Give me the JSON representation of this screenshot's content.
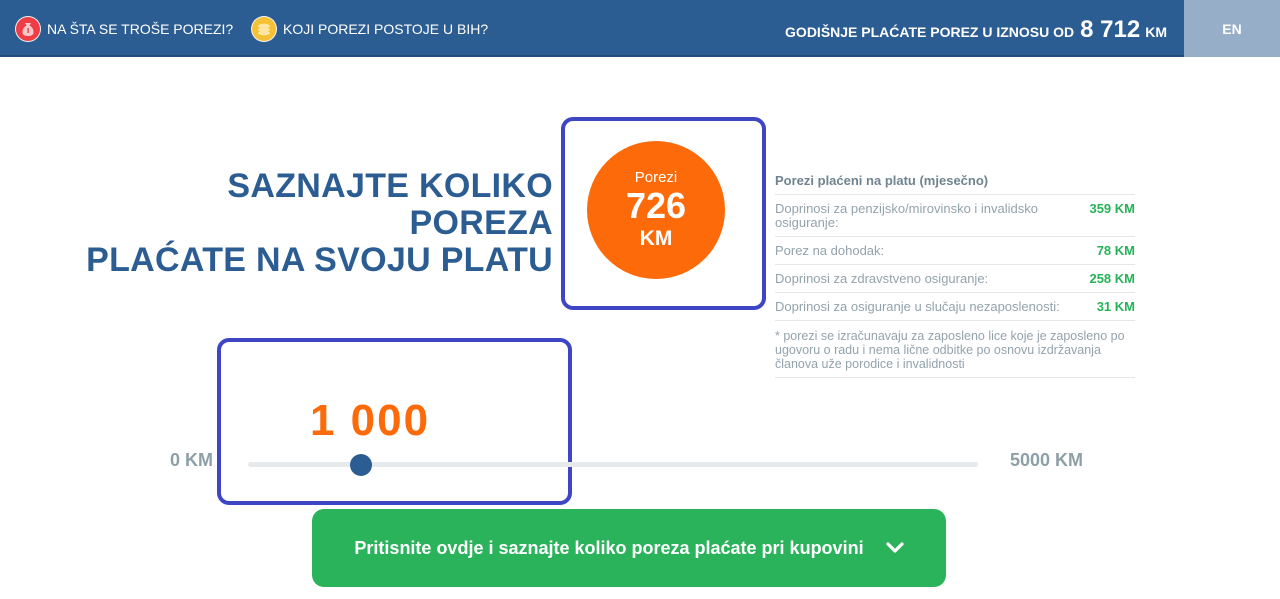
{
  "nav": {
    "items": [
      {
        "label": "NA ŠTA SE TROŠE POREZI?",
        "icon": "money-bag-icon"
      },
      {
        "label": "KOJI POREZI POSTOJE U BIH?",
        "icon": "coins-icon"
      }
    ],
    "total_prefix": "GODIŠNJE PLAĆATE POREZ U IZNOSU OD",
    "total_amount": "8 712",
    "total_currency": "KM",
    "language": "EN"
  },
  "headline": {
    "line1": "SAZNAJTE KOLIKO POREZA",
    "line2": "PLAĆATE NA SVOJU PLATU"
  },
  "summary": {
    "label": "Porezi",
    "value": "726",
    "currency": "KM"
  },
  "breakdown": {
    "title": "Porezi plaćeni na platu (mjesečno)",
    "rows": [
      {
        "label": "Doprinosi za penzijsko/mirovinsko i invalidsko osiguranje:",
        "value": "359 KM"
      },
      {
        "label": "Porez na dohodak:",
        "value": "78 KM"
      },
      {
        "label": "Doprinosi za zdravstveno osiguranje:",
        "value": "258 KM"
      },
      {
        "label": "Doprinosi za osiguranje u slučaju nezaposlenosti:",
        "value": "31 KM"
      }
    ],
    "note": "* porezi se izračunavaju za zaposleno lice koje je zaposleno po ugovoru o radu i nema lične odbitke po osnovu izdržavanja članova uže porodice i invalidnosti"
  },
  "salary": {
    "display": "1 000",
    "min_label": "0 KM",
    "max_label": "5000 KM",
    "value": 1000,
    "min": 0,
    "max": 5000
  },
  "cta": {
    "label": "Pritisnite ovdje i saznajte koliko poreza plaćate pri kupovini",
    "icon": "chevron-down-icon"
  },
  "colors": {
    "navbar": "#2c5d92",
    "accent_orange": "#fd6a0a",
    "accent_green": "#2bb35b",
    "highlight_frame": "#3f46c5",
    "value_green": "#27b259"
  }
}
